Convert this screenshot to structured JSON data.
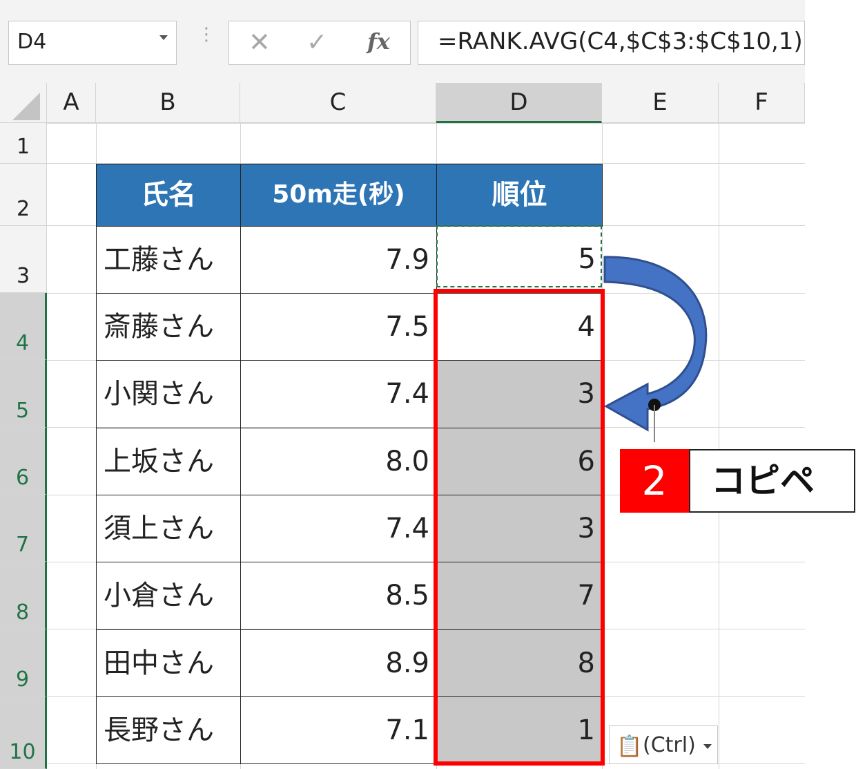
{
  "formula_bar": {
    "name_box": "D4",
    "formula": "=RANK.AVG(C4,$C$3:$C$10,1)",
    "fx_label": "fx"
  },
  "columns": [
    "A",
    "B",
    "C",
    "D",
    "E",
    "F"
  ],
  "rows": [
    "1",
    "2",
    "3",
    "4",
    "5",
    "6",
    "7",
    "8",
    "9",
    "10"
  ],
  "table": {
    "headers": [
      "氏名",
      "50m走(秒)",
      "順位"
    ],
    "names": [
      "工藤さん",
      "斎藤さん",
      "小関さん",
      "上坂さん",
      "須上さん",
      "小倉さん",
      "田中さん",
      "長野さん"
    ],
    "times": [
      "7.9",
      "7.5",
      "7.4",
      "8.0",
      "7.4",
      "8.5",
      "8.9",
      "7.1"
    ],
    "ranks": [
      "5",
      "4",
      "3",
      "6",
      "3",
      "7",
      "8",
      "1"
    ]
  },
  "annotation": {
    "step_number": "2",
    "step_label": "コピペ"
  },
  "paste_options": {
    "label": "(Ctrl)"
  },
  "colors": {
    "header_fill": "#2e75b6",
    "highlight_red": "#ff0000",
    "arrow_blue": "#3b5fa8",
    "selection_green": "#217346"
  }
}
